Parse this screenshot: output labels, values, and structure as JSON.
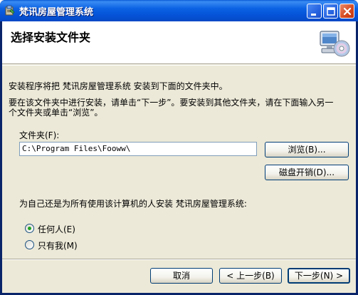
{
  "window": {
    "title": "梵讯房屋管理系统"
  },
  "header": {
    "title": "选择安装文件夹",
    "icon": "computer-cd-icon"
  },
  "body": {
    "intro": "安装程序将把 梵讯房屋管理系统 安装到下面的文件夹中。",
    "instruction_line1": "要在该文件夹中进行安装，请单击“下一步”。要安装到其他文件夹，请在下面输入另一",
    "instruction_line2": "个文件夹或单击“浏览”。",
    "folder_label": "文件夹(F):",
    "folder_value": "C:\\Program Files\\Fooww\\",
    "browse_label": "浏览(B)...",
    "disk_cost_label": "磁盘开销(D)...",
    "user_question": "为自己还是为所有使用该计算机的人安装 梵讯房屋管理系统:",
    "options": [
      {
        "label": "任何人(E)",
        "selected": true
      },
      {
        "label": "只有我(M)",
        "selected": false
      }
    ]
  },
  "footer": {
    "cancel_label": "取消",
    "back_label": "< 上一步(B)",
    "next_label": "下一步(N) >"
  },
  "colors": {
    "titlebar": "#0553d8",
    "client_bg": "#ece9d8",
    "button_border": "#003c74",
    "radio_selected": "#21a121"
  }
}
